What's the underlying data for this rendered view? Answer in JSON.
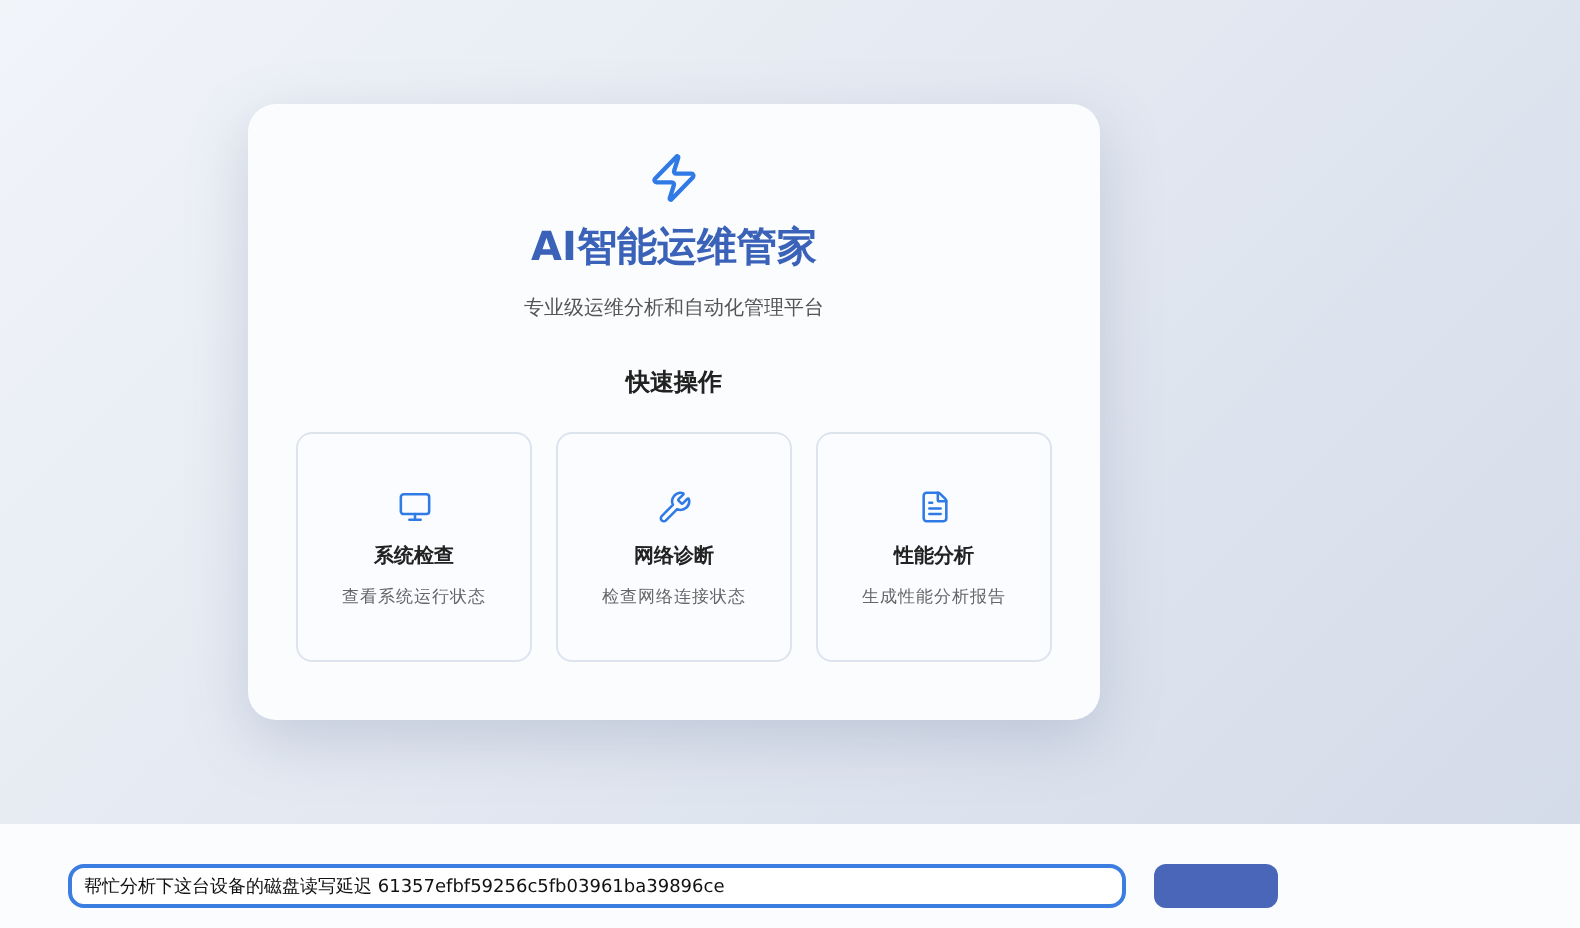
{
  "hero": {
    "title": "AI智能运维管家",
    "subtitle": "专业级运维分析和自动化管理平台"
  },
  "quick_actions": {
    "heading": "快速操作",
    "items": [
      {
        "kind": "monitor",
        "title": "系统检查",
        "description": "查看系统运行状态"
      },
      {
        "kind": "wrench",
        "title": "网络诊断",
        "description": "检查网络连接状态"
      },
      {
        "kind": "file",
        "title": "性能分析",
        "description": "生成性能分析报告"
      }
    ]
  },
  "composer": {
    "value": "帮忙分析下这台设备的磁盘读写延迟 61357efbf59256c5fb03961ba39896ce"
  }
}
